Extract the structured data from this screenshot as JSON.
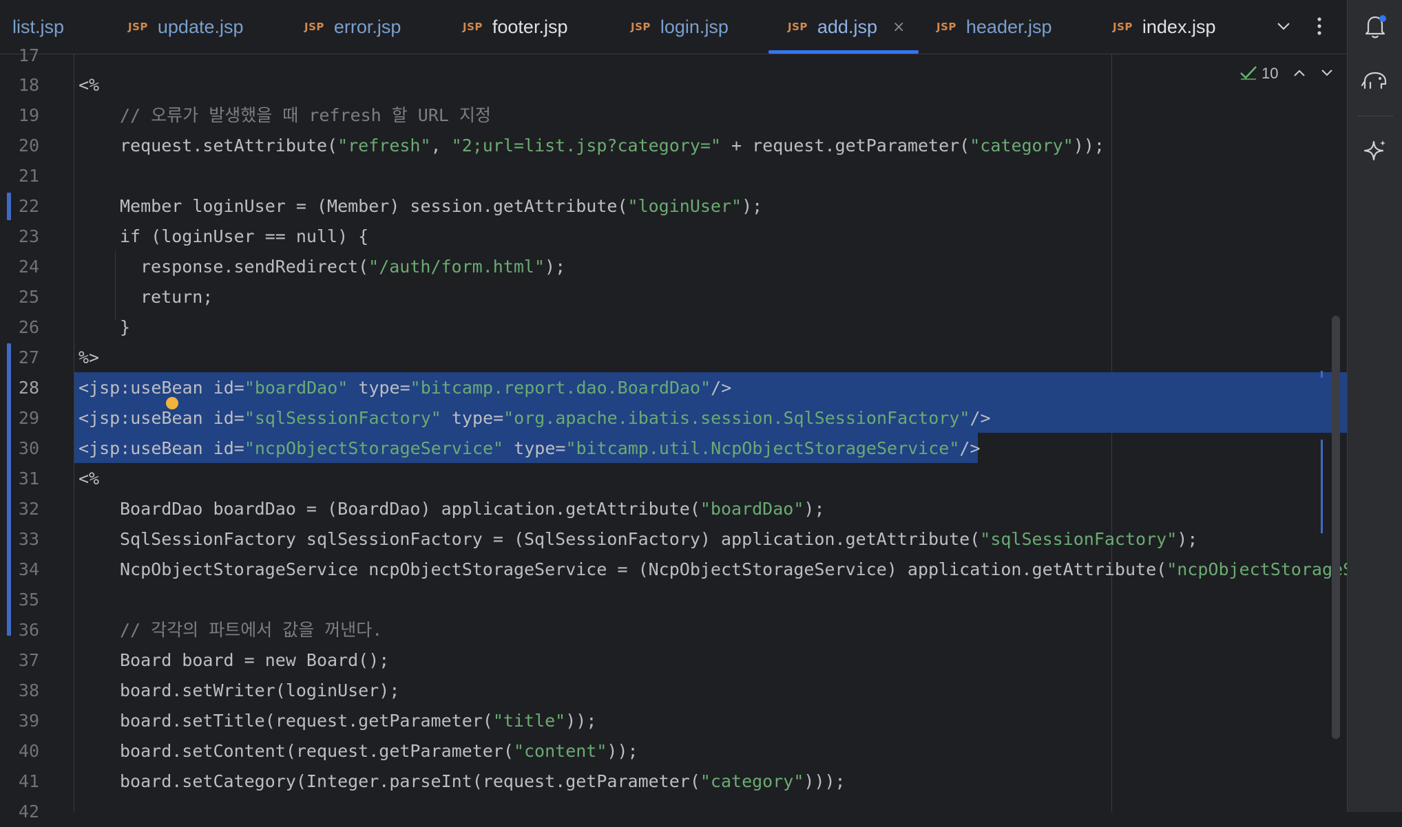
{
  "tabs": [
    {
      "label": "list.jsp",
      "icon": "",
      "plain": false
    },
    {
      "label": "update.jsp",
      "icon": "JSP",
      "plain": false
    },
    {
      "label": "error.jsp",
      "icon": "JSP",
      "plain": false
    },
    {
      "label": "footer.jsp",
      "icon": "JSP",
      "plain": true
    },
    {
      "label": "login.jsp",
      "icon": "JSP",
      "plain": false
    },
    {
      "label": "add.jsp",
      "icon": "JSP",
      "plain": false,
      "active": true
    },
    {
      "label": "header.jsp",
      "icon": "JSP",
      "plain": false
    },
    {
      "label": "index.jsp",
      "icon": "JSP",
      "plain": true
    }
  ],
  "tab_close_glyph": "×",
  "inspections": {
    "count": "10"
  },
  "gutter": {
    "line_numbers": [
      "17",
      "18",
      "19",
      "20",
      "21",
      "22",
      "23",
      "24",
      "25",
      "26",
      "27",
      "28",
      "29",
      "30",
      "31",
      "32",
      "33",
      "34",
      "35",
      "36",
      "37",
      "38",
      "39",
      "40",
      "41",
      "42"
    ],
    "current_line": "28"
  },
  "code": {
    "l18_a": "<%",
    "l19_comment": "// 오류가 발생했을 때 refresh 할 URL 지정",
    "l20_a": "request.setAttribute(",
    "l20_s1": "\"refresh\"",
    "l20_b": ", ",
    "l20_s2": "\"2;url=list.jsp?category=\"",
    "l20_c": " + request.getParameter(",
    "l20_s3": "\"category\"",
    "l20_d": "));",
    "l22_a": "Member loginUser = (Member) session.getAttribute(",
    "l22_s1": "\"loginUser\"",
    "l22_b": ");",
    "l23_a": "if (loginUser == null) {",
    "l24_a": "response.sendRedirect(",
    "l24_s1": "\"/auth/form.html\"",
    "l24_b": ");",
    "l25_a": "return;",
    "l26_a": "}",
    "l27_a": "%>",
    "l28_a": "<jsp:useBean id=",
    "l28_s1": "\"boardDao\"",
    "l28_b": " type=",
    "l28_s2": "\"bitcamp.report.dao.BoardDao\"",
    "l28_c": "/>",
    "l29_a": "<jsp:useBean id=",
    "l29_s1": "\"sqlSessionFactory\"",
    "l29_b": " type=",
    "l29_s2": "\"org.apache.ibatis.session.SqlSessionFactory\"",
    "l29_c": "/>",
    "l30_a": "<jsp:useBean id=",
    "l30_s1": "\"ncpObjectStorageService\"",
    "l30_b": " type=",
    "l30_s2": "\"bitcamp.util.NcpObjectStorageService\"",
    "l30_c": "/>",
    "l31_a": "<%",
    "l32_a": "BoardDao boardDao = (BoardDao) application.getAttribute(",
    "l32_s1": "\"boardDao\"",
    "l32_b": ");",
    "l33_a": "SqlSessionFactory sqlSessionFactory = (SqlSessionFactory) application.getAttribute(",
    "l33_s1": "\"sqlSessionFactory\"",
    "l33_b": ");",
    "l34_a": "NcpObjectStorageService ncpObjectStorageService = (NcpObjectStorageService) application.getAttribute(",
    "l34_s1": "\"ncpObjectStorageS",
    "l36_comment": "// 각각의 파트에서 값을 꺼낸다.",
    "l37_a": "Board board = new Board();",
    "l38_a": "board.setWriter(loginUser);",
    "l39_a": "board.setTitle(request.getParameter(",
    "l39_s1": "\"title\"",
    "l39_b": "));",
    "l40_a": "board.setContent(request.getParameter(",
    "l40_s1": "\"content\"",
    "l40_b": "));",
    "l41_a": "board.setCategory(Integer.parseInt(request.getParameter(",
    "l41_s1": "\"category\"",
    "l41_b": ")));"
  },
  "colors": {
    "accent": "#3574f0",
    "selection": "#214283",
    "string": "#6aab73",
    "comment": "#7a7e85",
    "tab_icon": "#d08a4e"
  },
  "icons": [
    "chevron-down-icon",
    "more-icon",
    "bell-icon",
    "elephant-icon",
    "ai-sparkle-icon",
    "check-icon",
    "arrow-up-icon",
    "arrow-down-icon",
    "bulb-icon"
  ]
}
